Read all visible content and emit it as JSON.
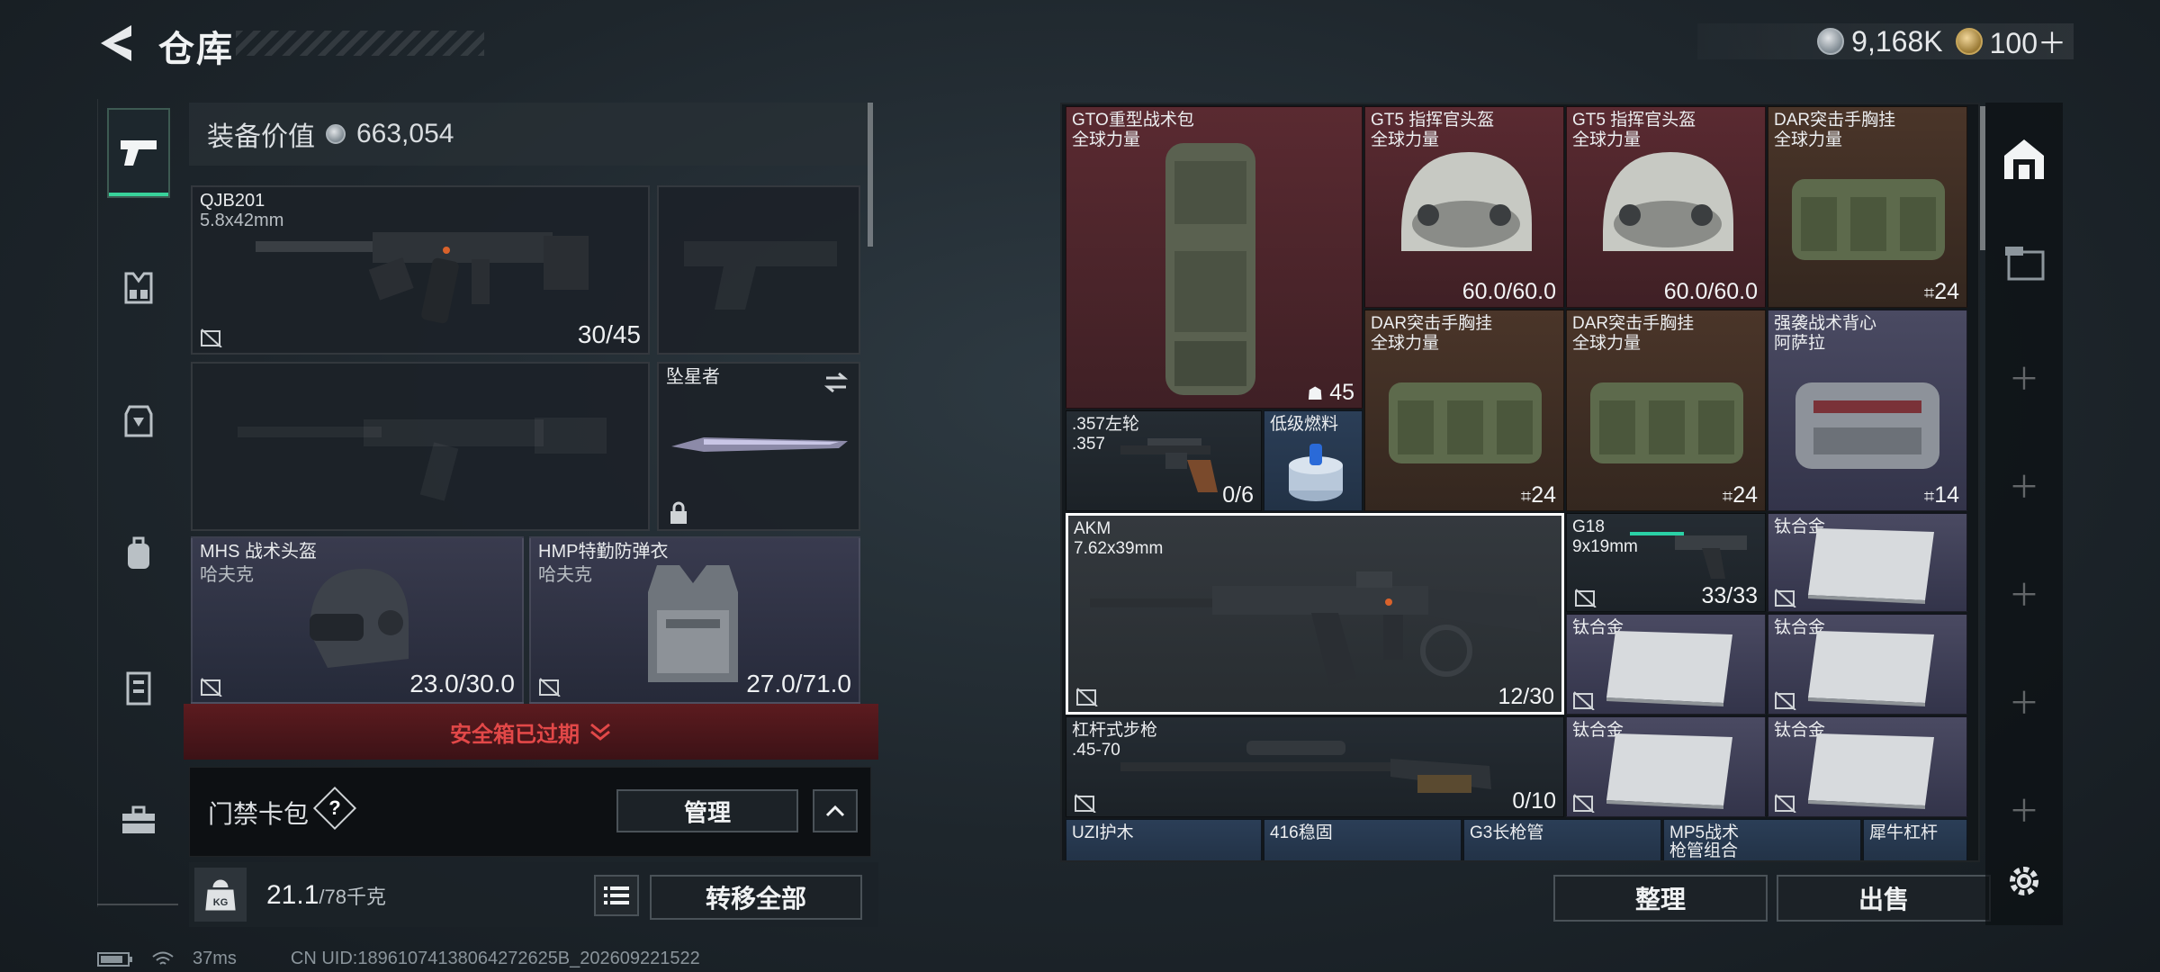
{
  "header": {
    "title": "仓库",
    "currency": [
      {
        "icon": "silver-coin-icon",
        "value": "9,168K"
      },
      {
        "icon": "gold-coin-icon",
        "value": "100＋"
      }
    ]
  },
  "rail": {
    "items": [
      {
        "icon": "pistol-icon",
        "active": true
      },
      {
        "icon": "chest-rig-icon",
        "active": false
      },
      {
        "icon": "body-armor-icon",
        "active": false
      },
      {
        "icon": "backpack-icon",
        "active": false
      },
      {
        "icon": "case-icon",
        "active": false
      },
      {
        "icon": "toolbox-icon",
        "active": false
      }
    ]
  },
  "loadout": {
    "equip_value_label": "装备价值",
    "equip_value": "663,054",
    "primary": {
      "name": "QJB201",
      "caliber": "5.8x42mm",
      "ammo": "30/45"
    },
    "secondary_name": "坠星者",
    "helmet": {
      "name": "MHS 战术头盔",
      "sub": "哈夫克",
      "durability": "23.0/30.0"
    },
    "armor": {
      "name": "HMP特勤防弹衣",
      "sub": "哈夫克",
      "durability": "27.0/71.0"
    },
    "safe_box": "安全箱已过期",
    "card_pack": "门禁卡包",
    "help": "?",
    "manage": "管理",
    "weight": "21.1",
    "weight_max": "/78千克",
    "weight_icon": "KG",
    "transfer_all": "转移全部"
  },
  "storage": {
    "items": [
      {
        "id": "gto",
        "name": "GTO重型战术包",
        "sub": "全球力量",
        "value": "45",
        "badge": "lock-icon"
      },
      {
        "id": "gt5a",
        "name": "GT5 指挥官头盔",
        "sub": "全球力量",
        "value": "60.0/60.0"
      },
      {
        "id": "gt5b",
        "name": "GT5 指挥官头盔",
        "sub": "全球力量",
        "value": "60.0/60.0"
      },
      {
        "id": "dar1",
        "name": "DAR突击手胸挂",
        "sub": "全球力量",
        "value": "24"
      },
      {
        "id": "dar2",
        "name": "DAR突击手胸挂",
        "sub": "全球力量",
        "value": "24"
      },
      {
        "id": "dar3",
        "name": "DAR突击手胸挂",
        "sub": "全球力量",
        "value": "24"
      },
      {
        "id": "vest",
        "name": "强袭战术背心",
        "sub": "阿萨拉",
        "value": "14"
      },
      {
        "id": "rev",
        "name": ".357左轮",
        "sub": ".357",
        "value": "0/6"
      },
      {
        "id": "fuel",
        "name": "低级燃料",
        "sub": "",
        "value": ""
      },
      {
        "id": "akm",
        "name": "AKM",
        "sub": "7.62x39mm",
        "value": "12/30"
      },
      {
        "id": "g18",
        "name": "G18",
        "sub": "9x19mm",
        "value": "33/33"
      },
      {
        "id": "ti1",
        "name": "钛合金",
        "sub": "",
        "value": ""
      },
      {
        "id": "ti2",
        "name": "钛合金",
        "sub": "",
        "value": ""
      },
      {
        "id": "ti3",
        "name": "钛合金",
        "sub": "",
        "value": ""
      },
      {
        "id": "ti4",
        "name": "钛合金",
        "sub": "",
        "value": ""
      },
      {
        "id": "ti5",
        "name": "钛合金",
        "sub": "",
        "value": ""
      },
      {
        "id": "lever",
        "name": "杠杆式步枪",
        "sub": ".45-70",
        "value": "0/10"
      },
      {
        "id": "uzi",
        "name": "UZI护木",
        "sub": "",
        "value": ""
      },
      {
        "id": "s416",
        "name": "416稳固",
        "sub": "",
        "value": ""
      },
      {
        "id": "g3",
        "name": "G3长枪管",
        "sub": "",
        "value": ""
      },
      {
        "id": "mp5",
        "name": "MP5战术",
        "sub": "枪管组合",
        "value": ""
      },
      {
        "id": "rhino",
        "name": "犀牛杠杆",
        "sub": "",
        "value": ""
      }
    ],
    "sort_button": "整理",
    "sell_button": "出售"
  },
  "status": {
    "ping": "37ms",
    "uid": "CN UID:18961074138064272625B_202609221522"
  }
}
